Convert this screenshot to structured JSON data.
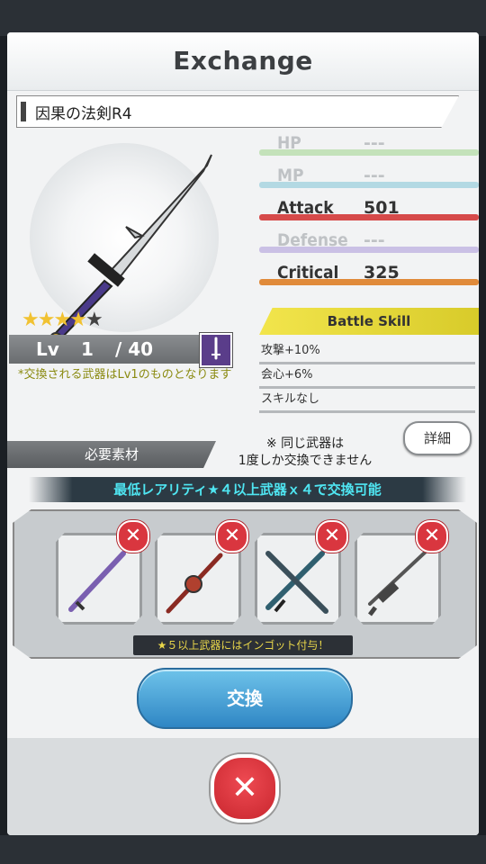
{
  "dialog": {
    "title": "Exchange"
  },
  "weapon": {
    "name": "因果の法剣R4",
    "rarity": 4,
    "max_rarity": 5,
    "level_label": "Lv",
    "level": "1",
    "level_max": "/ 40",
    "type_icon": "one-handed-sword-icon",
    "note": "*交換される武器はLv1のものとなります"
  },
  "stats": [
    {
      "label": "HP",
      "value": "---",
      "color": "#9fd38a",
      "dim": true
    },
    {
      "label": "MP",
      "value": "---",
      "color": "#7fc3d6",
      "dim": true
    },
    {
      "label": "Attack",
      "value": "501",
      "color": "#d64a4a",
      "dim": false
    },
    {
      "label": "Defense",
      "value": "---",
      "color": "#a995d8",
      "dim": true
    },
    {
      "label": "Critical",
      "value": "325",
      "color": "#e08a3a",
      "dim": false
    }
  ],
  "battle_skill": {
    "title": "Battle Skill",
    "lines": [
      "攻撃+10%",
      "会心+6%",
      "スキルなし"
    ]
  },
  "detail_button": "詳細",
  "materials": {
    "header": "必要素材",
    "once_note": "※ 同じ武器は\n1度しか交換できません",
    "requirement": "最低レアリティ★４以上武器ｘ４で交換可能",
    "ingot_note": "★５以上武器にはインゴット付与！",
    "slots": [
      {
        "icon": "purple-sword-icon"
      },
      {
        "icon": "red-sword-icon"
      },
      {
        "icon": "crossed-swords-icon"
      },
      {
        "icon": "rifle-icon"
      }
    ],
    "remove_icon": "remove-x-icon"
  },
  "exchange_button": "交換",
  "close_button": "close-x-icon",
  "colors": {
    "accent_blue": "#2f86c4",
    "remove_red": "#d9363f",
    "skill_yellow": "#f2e54c",
    "cyan_text": "#4fe6f2"
  }
}
